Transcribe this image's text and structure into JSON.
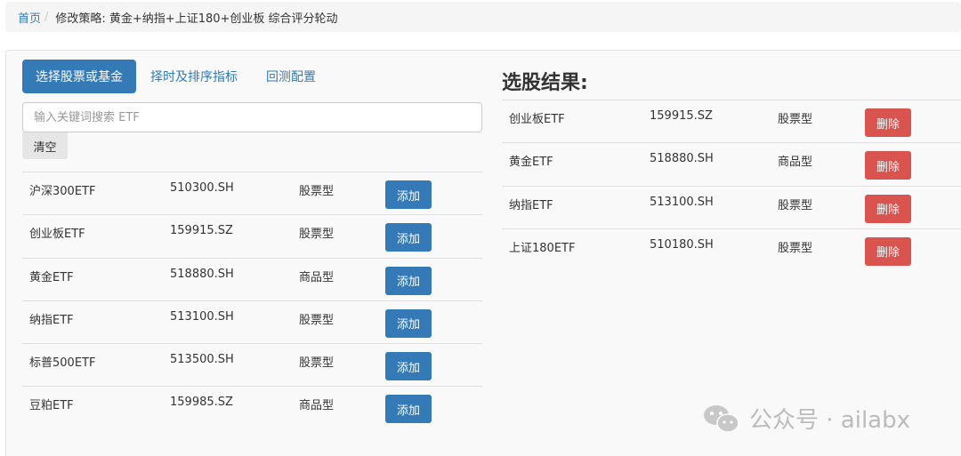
{
  "breadcrumb": {
    "home": "首页",
    "separator": "/",
    "current": "修改策略: 黄金+纳指+上证180+创业板 综合评分轮动"
  },
  "tabs": [
    {
      "label": "选择股票或基金",
      "active": true
    },
    {
      "label": "择时及排序指标",
      "active": false
    },
    {
      "label": "回测配置",
      "active": false
    }
  ],
  "search": {
    "placeholder": "输入关键词搜索 ETF",
    "value": ""
  },
  "clear_label": "清空",
  "candidates": [
    {
      "name": "沪深300ETF",
      "code": "510300.SH",
      "type": "股票型",
      "action": "添加"
    },
    {
      "name": "创业板ETF",
      "code": "159915.SZ",
      "type": "股票型",
      "action": "添加"
    },
    {
      "name": "黄金ETF",
      "code": "518880.SH",
      "type": "商品型",
      "action": "添加"
    },
    {
      "name": "纳指ETF",
      "code": "513100.SH",
      "type": "股票型",
      "action": "添加"
    },
    {
      "name": "标普500ETF",
      "code": "513500.SH",
      "type": "股票型",
      "action": "添加"
    },
    {
      "name": "豆粕ETF",
      "code": "159985.SZ",
      "type": "商品型",
      "action": "添加"
    }
  ],
  "result_title": "选股结果:",
  "selected": [
    {
      "name": "创业板ETF",
      "code": "159915.SZ",
      "type": "股票型",
      "action": "删除"
    },
    {
      "name": "黄金ETF",
      "code": "518880.SH",
      "type": "商品型",
      "action": "删除"
    },
    {
      "name": "纳指ETF",
      "code": "513100.SH",
      "type": "股票型",
      "action": "删除"
    },
    {
      "name": "上证180ETF",
      "code": "510180.SH",
      "type": "股票型",
      "action": "删除"
    }
  ],
  "watermark": {
    "text": "公众号 · ailabx",
    "icon": "wechat-icon"
  },
  "colors": {
    "primary": "#337ab7",
    "danger": "#d9534f",
    "breadcrumb_bg": "#f5f5f5",
    "panel_bg": "#f9f9f9"
  }
}
